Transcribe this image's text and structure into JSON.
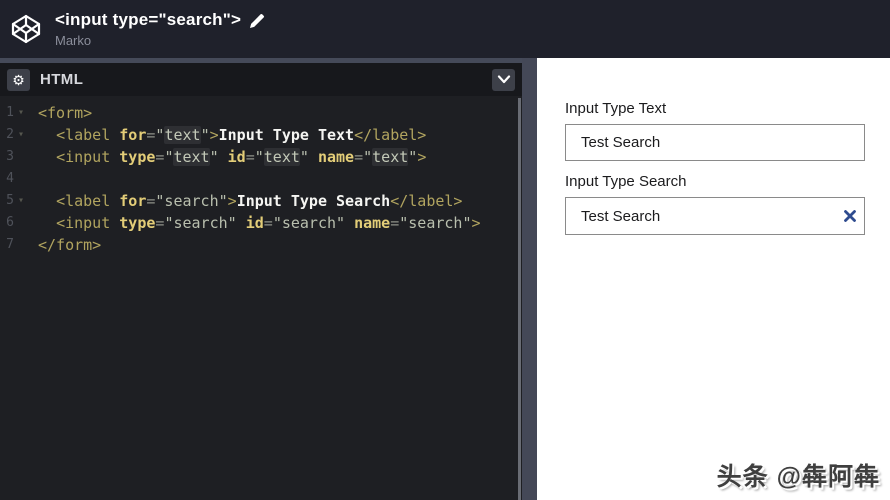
{
  "header": {
    "title": "<input type=\"search\">",
    "author": "Marko"
  },
  "editor": {
    "panel_label": "HTML",
    "fold_glyph": "▾",
    "gear_glyph": "⚙",
    "code_lines": [
      {
        "num": "1",
        "fold": true,
        "tokens": [
          {
            "t": "tag",
            "v": "<form>"
          }
        ]
      },
      {
        "num": "2",
        "fold": true,
        "tokens": [
          {
            "t": "plain",
            "v": "  "
          },
          {
            "t": "tag",
            "v": "<label "
          },
          {
            "t": "attr",
            "v": "for"
          },
          {
            "t": "punc",
            "v": "="
          },
          {
            "t": "str",
            "v": "\""
          },
          {
            "t": "strhl",
            "v": "text"
          },
          {
            "t": "str",
            "v": "\""
          },
          {
            "t": "tag",
            "v": ">"
          },
          {
            "t": "text",
            "v": "Input Type Text"
          },
          {
            "t": "tag",
            "v": "</label>"
          }
        ]
      },
      {
        "num": "3",
        "fold": false,
        "tokens": [
          {
            "t": "plain",
            "v": "  "
          },
          {
            "t": "tag",
            "v": "<input "
          },
          {
            "t": "attr",
            "v": "type"
          },
          {
            "t": "punc",
            "v": "="
          },
          {
            "t": "str",
            "v": "\""
          },
          {
            "t": "strhl",
            "v": "text"
          },
          {
            "t": "str",
            "v": "\""
          },
          {
            "t": "plain",
            "v": " "
          },
          {
            "t": "attr",
            "v": "id"
          },
          {
            "t": "punc",
            "v": "="
          },
          {
            "t": "str",
            "v": "\""
          },
          {
            "t": "strhl",
            "v": "text"
          },
          {
            "t": "str",
            "v": "\""
          },
          {
            "t": "plain",
            "v": " "
          },
          {
            "t": "attr",
            "v": "name"
          },
          {
            "t": "punc",
            "v": "="
          },
          {
            "t": "str",
            "v": "\""
          },
          {
            "t": "strhl",
            "v": "text"
          },
          {
            "t": "str",
            "v": "\""
          },
          {
            "t": "tag",
            "v": ">"
          }
        ]
      },
      {
        "num": "4",
        "fold": false,
        "tokens": []
      },
      {
        "num": "5",
        "fold": true,
        "tokens": [
          {
            "t": "plain",
            "v": "  "
          },
          {
            "t": "tag",
            "v": "<label "
          },
          {
            "t": "attr",
            "v": "for"
          },
          {
            "t": "punc",
            "v": "="
          },
          {
            "t": "str",
            "v": "\"search\""
          },
          {
            "t": "tag",
            "v": ">"
          },
          {
            "t": "text",
            "v": "Input Type Search"
          },
          {
            "t": "tag",
            "v": "</label>"
          }
        ]
      },
      {
        "num": "6",
        "fold": false,
        "tokens": [
          {
            "t": "plain",
            "v": "  "
          },
          {
            "t": "tag",
            "v": "<input "
          },
          {
            "t": "attr",
            "v": "type"
          },
          {
            "t": "punc",
            "v": "="
          },
          {
            "t": "str",
            "v": "\"search\""
          },
          {
            "t": "plain",
            "v": " "
          },
          {
            "t": "attr",
            "v": "id"
          },
          {
            "t": "punc",
            "v": "="
          },
          {
            "t": "str",
            "v": "\"search\""
          },
          {
            "t": "plain",
            "v": " "
          },
          {
            "t": "attr",
            "v": "name"
          },
          {
            "t": "punc",
            "v": "="
          },
          {
            "t": "str",
            "v": "\"search\""
          },
          {
            "t": "tag",
            "v": ">"
          }
        ]
      },
      {
        "num": "7",
        "fold": false,
        "tokens": [
          {
            "t": "tag",
            "v": "</form>"
          }
        ]
      }
    ]
  },
  "preview": {
    "fields": [
      {
        "label": "Input Type Text",
        "value": "Test Search",
        "type": "text",
        "clearable": false
      },
      {
        "label": "Input Type Search",
        "value": "Test Search",
        "type": "search",
        "clearable": true
      }
    ]
  },
  "watermark": {
    "text": "头条 @犇阿犇"
  },
  "colors": {
    "header_bg": "#1f212b",
    "panel_bar_bg": "#17181c",
    "editor_bg": "#1e1f23",
    "divider": "#444857",
    "button_bg": "#3d4049",
    "tag": "#b1a45f",
    "attr": "#e3cd78",
    "string": "#b9bfae",
    "content_text": "#f5f5f2",
    "clear_x": "#2e4b8f",
    "input_border": "#8a8a8a"
  }
}
